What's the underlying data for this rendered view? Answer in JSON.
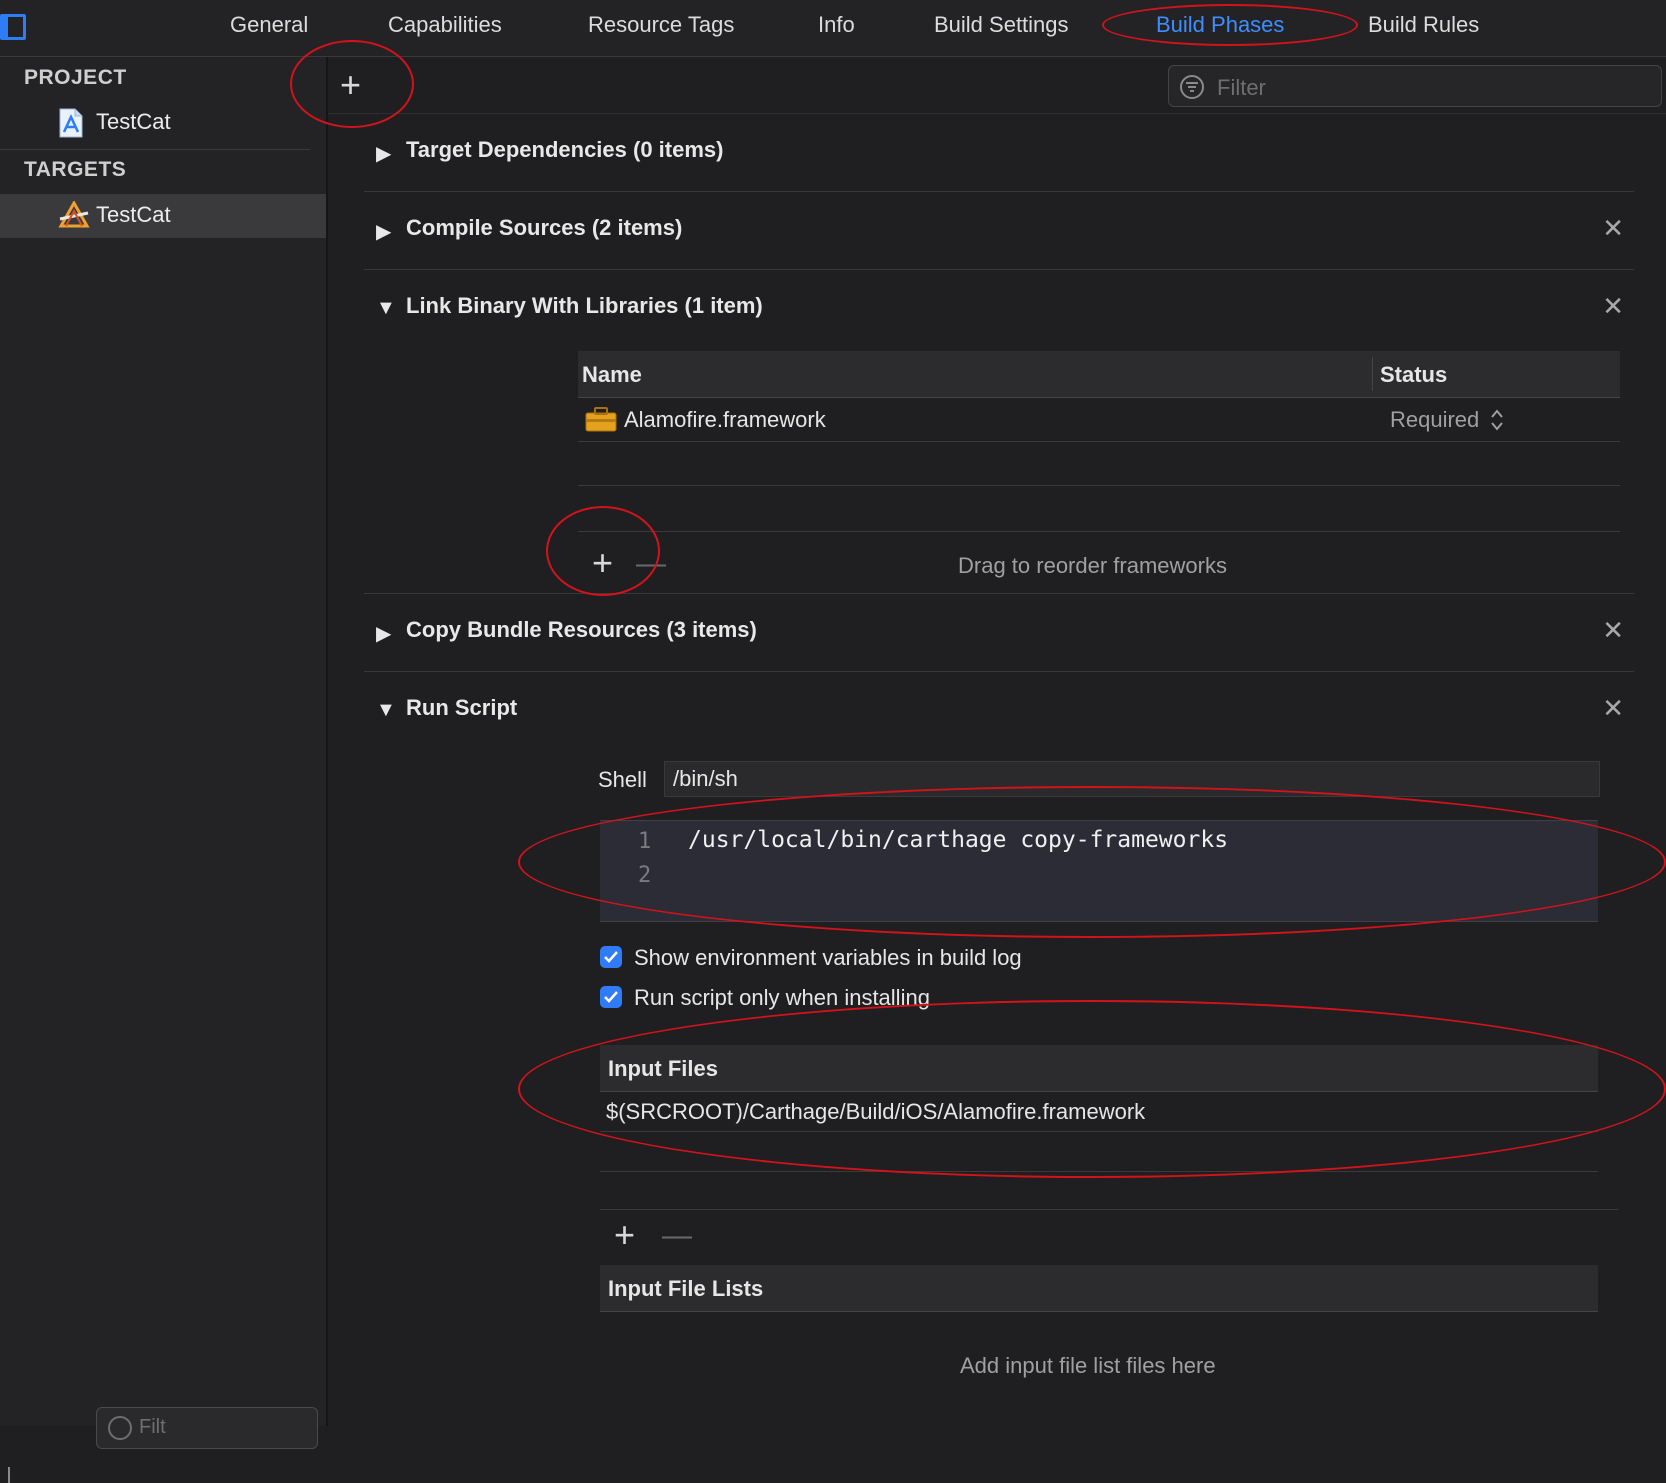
{
  "tabs": [
    {
      "label": "General",
      "active": false
    },
    {
      "label": "Capabilities",
      "active": false
    },
    {
      "label": "Resource Tags",
      "active": false
    },
    {
      "label": "Info",
      "active": false
    },
    {
      "label": "Build Settings",
      "active": false
    },
    {
      "label": "Build Phases",
      "active": true
    },
    {
      "label": "Build Rules",
      "active": false
    }
  ],
  "sidebar": {
    "project_header": "PROJECT",
    "project_name": "TestCat",
    "targets_header": "TARGETS",
    "target_name": "TestCat",
    "filter_placeholder": "Filt"
  },
  "toolbar": {
    "add_symbol": "+",
    "filter_placeholder": "Filter"
  },
  "phases": {
    "target_dependencies": "Target Dependencies (0 items)",
    "compile_sources": "Compile Sources (2 items)",
    "link_binary": "Link Binary With Libraries (1 item)",
    "copy_bundle": "Copy Bundle Resources (3 items)",
    "run_script": "Run Script"
  },
  "close_symbol": "✕",
  "link_table": {
    "col_name": "Name",
    "col_status": "Status",
    "rows": [
      {
        "name": "Alamofire.framework",
        "status": "Required"
      }
    ],
    "add_symbol": "+",
    "remove_symbol": "—",
    "hint": "Drag to reorder frameworks"
  },
  "run_script": {
    "shell_label": "Shell",
    "shell_value": "/bin/sh",
    "line_numbers": [
      "1",
      "2"
    ],
    "code_lines": [
      "/usr/local/bin/carthage copy-frameworks",
      ""
    ],
    "show_env_label": "Show environment variables in build log",
    "show_env_checked": true,
    "install_only_label": "Run script only when installing",
    "install_only_checked": true,
    "input_files_header": "Input Files",
    "input_files": [
      "$(SRCROOT)/Carthage/Build/iOS/Alamofire.framework"
    ],
    "add_symbol": "+",
    "remove_symbol": "—",
    "input_file_lists_header": "Input File Lists",
    "input_file_lists_hint": "Add input file list files here"
  },
  "colors": {
    "accent": "#3f8cff",
    "annotation": "#d3131b",
    "background": "#1f1f21"
  }
}
